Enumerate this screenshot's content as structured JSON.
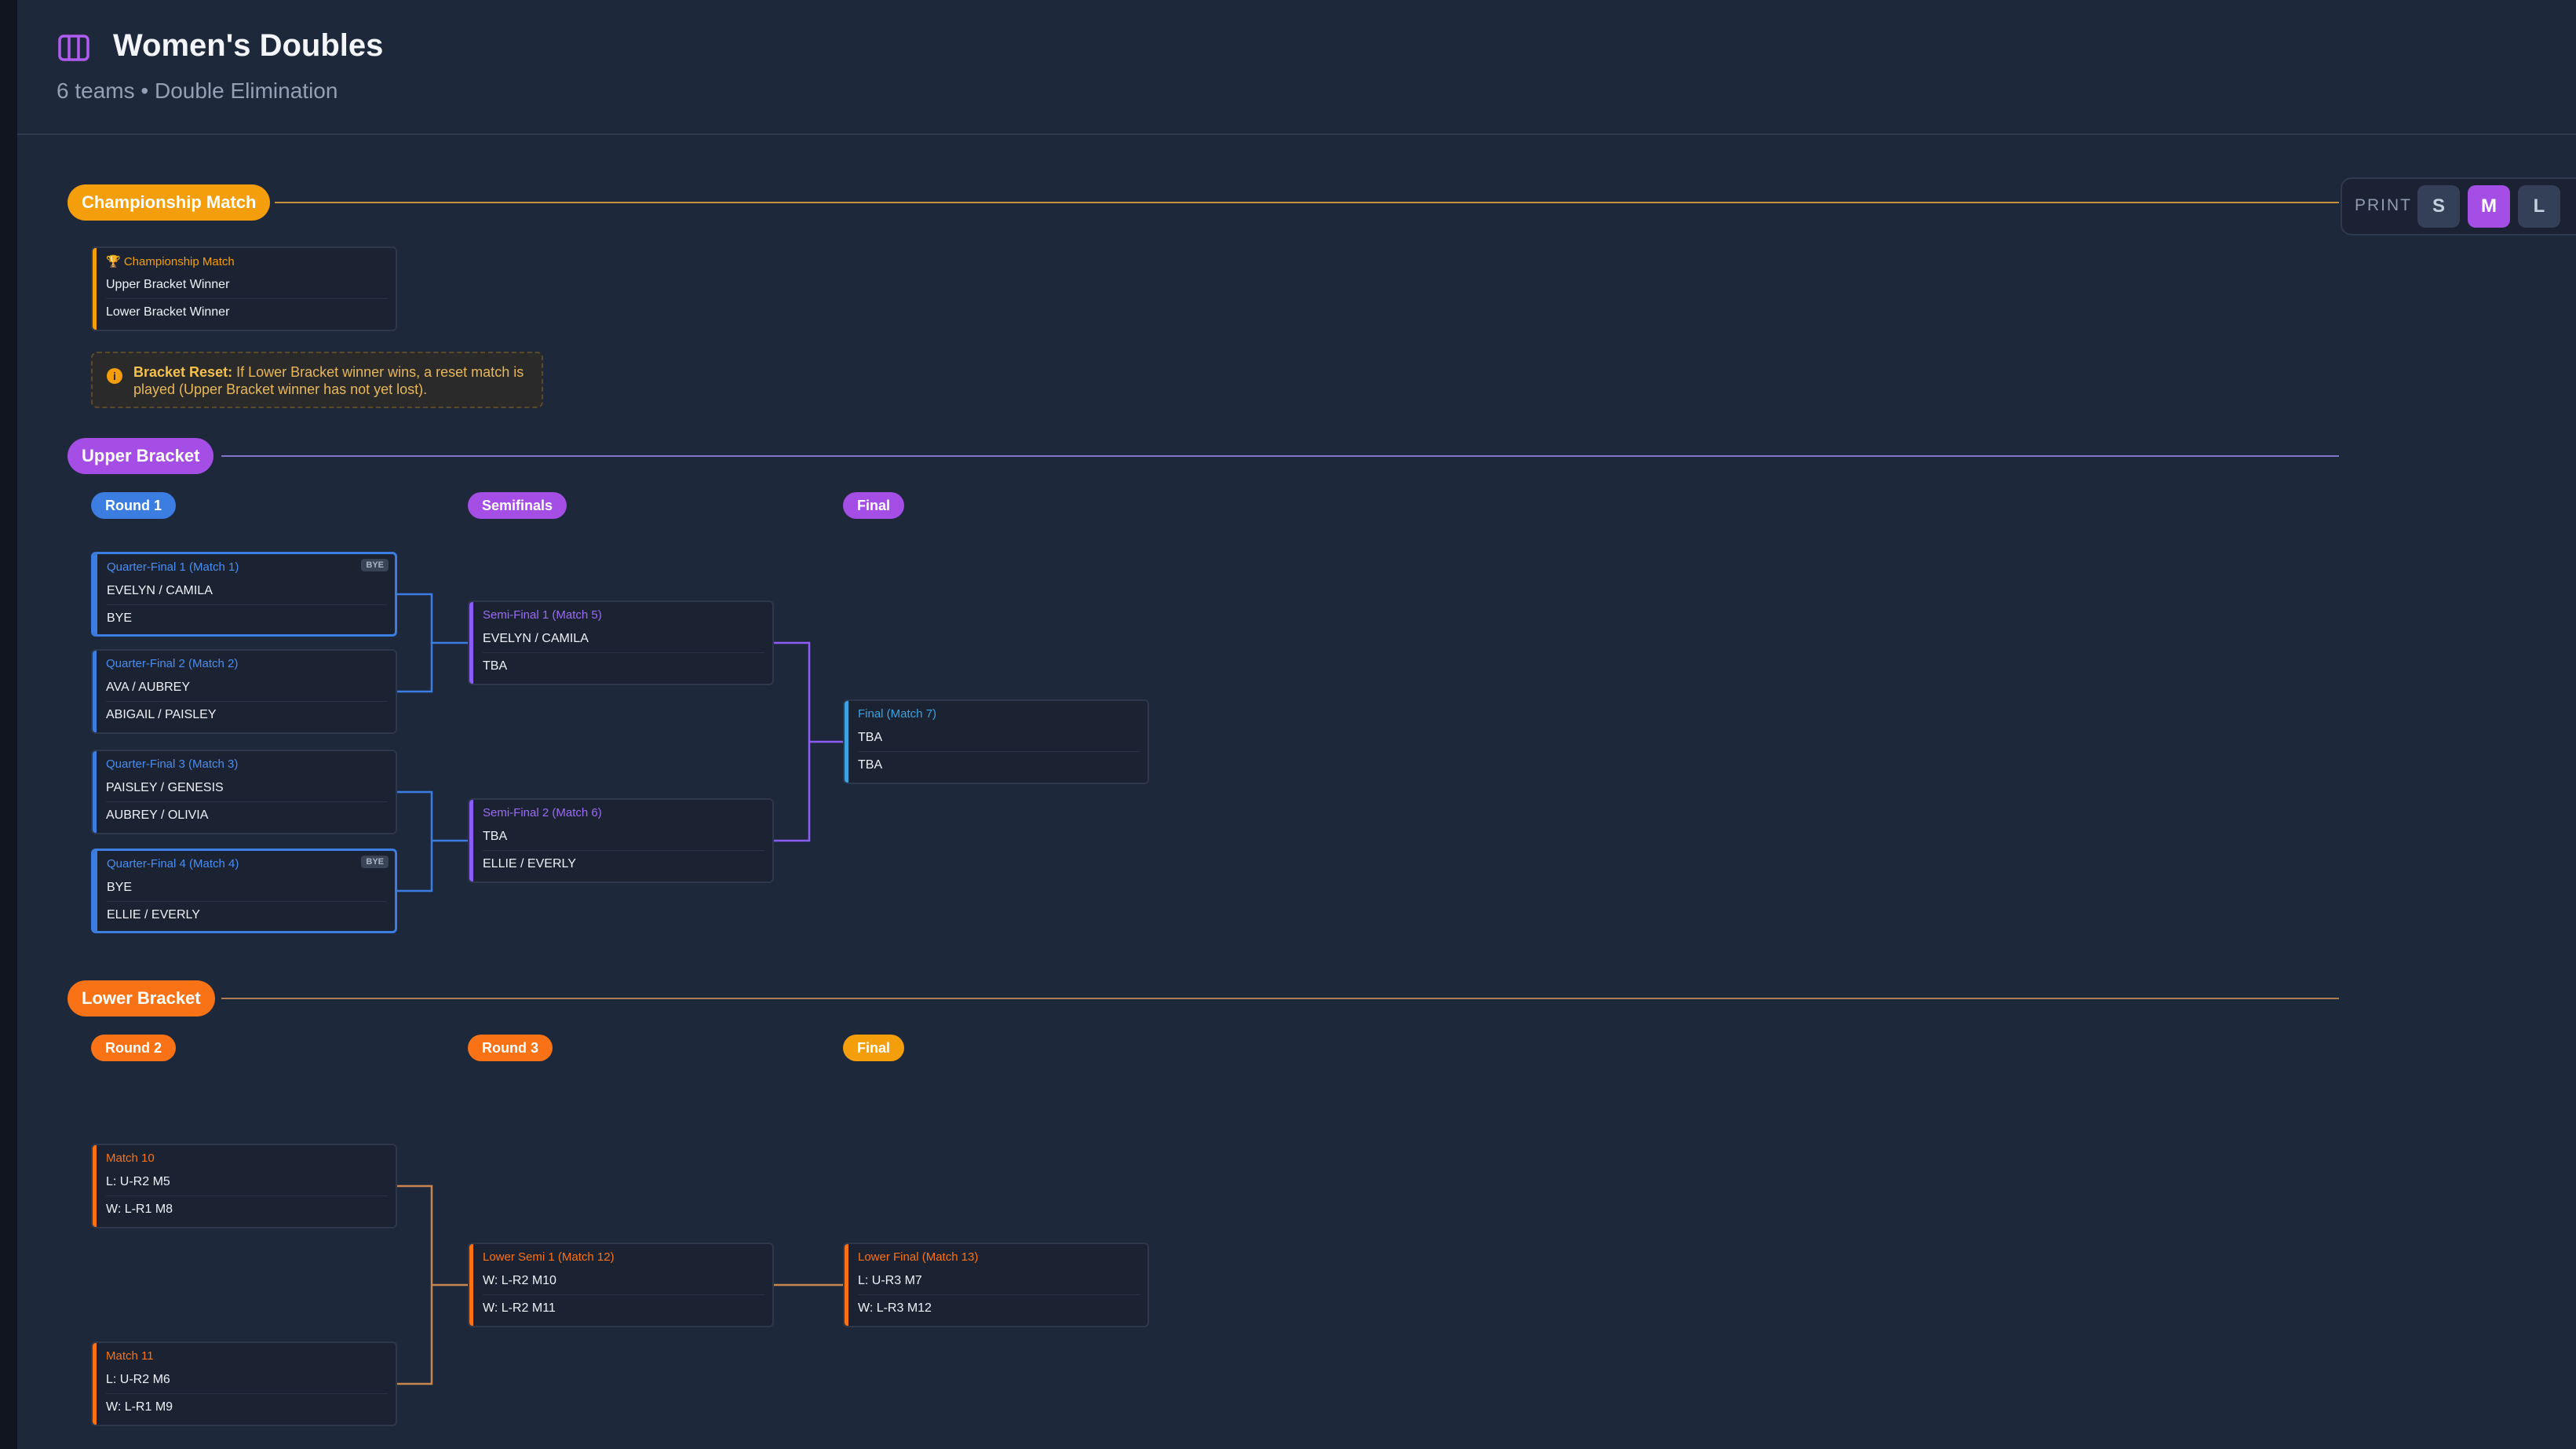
{
  "header": {
    "title": "Women's Doubles",
    "teams": "6 teams",
    "separator": "•",
    "format": "Double Elimination"
  },
  "size_selector": {
    "label": "PRINT",
    "options": [
      "S",
      "M",
      "L"
    ],
    "selected": "M"
  },
  "championship": {
    "section_label": "Championship Match",
    "match": {
      "title": "🏆 Championship Match",
      "slot1": "Upper Bracket Winner",
      "slot2": "Lower Bracket Winner"
    },
    "notice": {
      "strong": "Bracket Reset:",
      "text": " If Lower Bracket winner wins, a reset match is played (Upper Bracket winner has not yet lost)."
    }
  },
  "upper": {
    "section_label": "Upper Bracket",
    "rounds": [
      "Round 1",
      "Semifinals",
      "Final"
    ],
    "matches": [
      {
        "title": "Quarter-Final 1 (Match 1)",
        "slot1": "EVELYN / CAMILA",
        "slot2": "BYE",
        "badge": "BYE"
      },
      {
        "title": "Quarter-Final 2 (Match 2)",
        "slot1": "AVA / AUBREY",
        "slot2": "ABIGAIL / PAISLEY"
      },
      {
        "title": "Quarter-Final 3 (Match 3)",
        "slot1": "PAISLEY / GENESIS",
        "slot2": "AUBREY / OLIVIA"
      },
      {
        "title": "Quarter-Final 4 (Match 4)",
        "slot1": "BYE",
        "slot2": "ELLIE / EVERLY",
        "badge": "BYE"
      },
      {
        "title": "Semi-Final 1 (Match 5)",
        "slot1": "EVELYN / CAMILA",
        "slot2": "TBA"
      },
      {
        "title": "Semi-Final 2 (Match 6)",
        "slot1": "TBA",
        "slot2": "ELLIE / EVERLY"
      },
      {
        "title": "Final (Match 7)",
        "slot1": "TBA",
        "slot2": "TBA"
      }
    ]
  },
  "lower": {
    "section_label": "Lower Bracket",
    "rounds": [
      "Round 2",
      "Round 3",
      "Final"
    ],
    "matches": [
      {
        "title": "Match 10",
        "slot1": "L: U-R2 M5",
        "slot2": "W: L-R1 M8"
      },
      {
        "title": "Match 11",
        "slot1": "L: U-R2 M6",
        "slot2": "W: L-R1 M9"
      },
      {
        "title": "Lower Semi 1 (Match 12)",
        "slot1": "W: L-R2 M10",
        "slot2": "W: L-R2 M11"
      },
      {
        "title": "Lower Final (Match 13)",
        "slot1": "L: U-R3 M7",
        "slot2": "W: L-R3 M12"
      }
    ]
  },
  "colors": {
    "background": "#1e283b",
    "championship": "#f59e0b",
    "upper_section": "#a44ee6",
    "upper_round1": "#3b7de0",
    "upper_semis": "#8b5cf6",
    "upper_final": "#3ba3e0",
    "lower": "#f97316",
    "selected_size": "#a44ee6"
  },
  "icons": {
    "header": "bracket-columns-icon",
    "notice": "info-icon",
    "trophy": "trophy-icon"
  }
}
